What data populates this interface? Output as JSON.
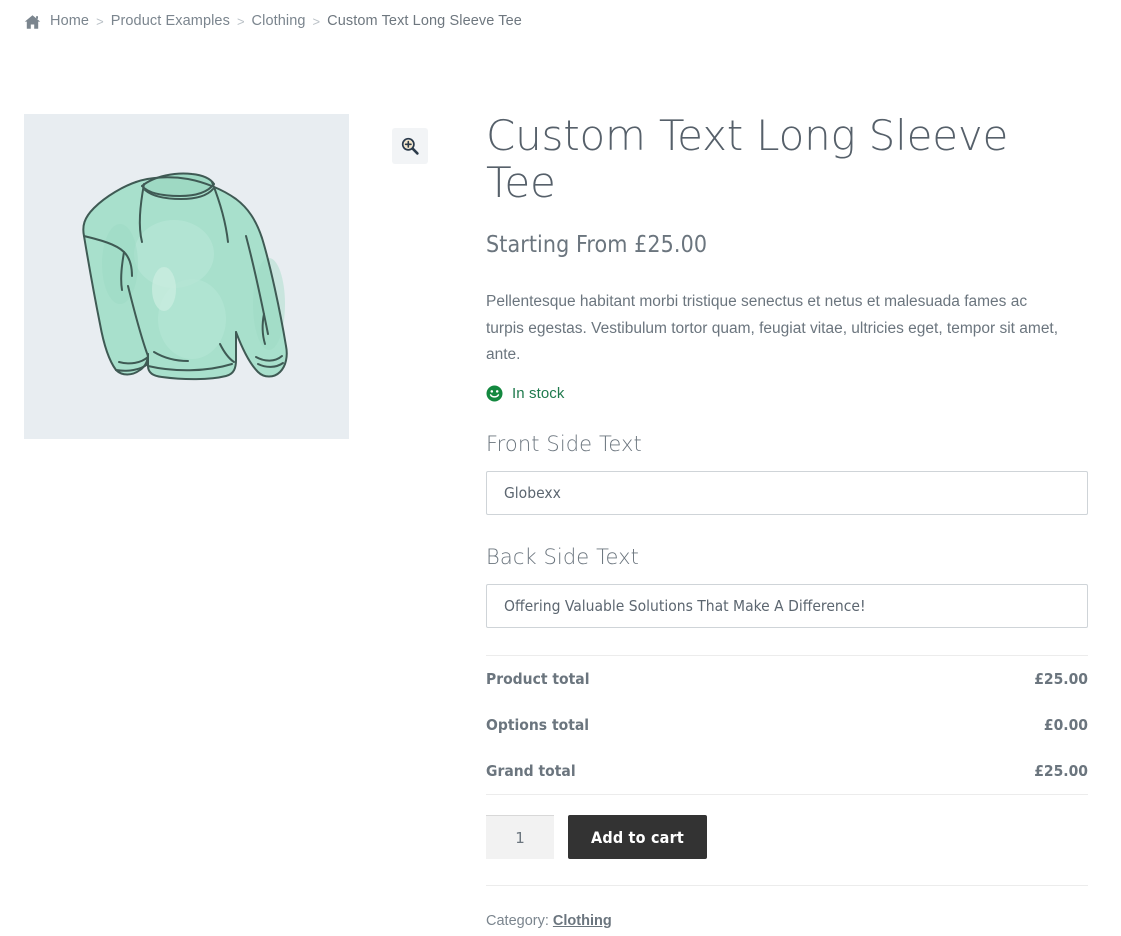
{
  "breadcrumb": {
    "home_icon": "home-icon",
    "separator": ">",
    "items": [
      {
        "label": "Home",
        "current": false
      },
      {
        "label": "Product Examples",
        "current": false
      },
      {
        "label": "Clothing",
        "current": false
      },
      {
        "label": "Custom Text Long Sleeve Tee",
        "current": true
      }
    ]
  },
  "gallery": {
    "zoom_icon": "zoom-in-magnifier-icon",
    "image_alt": "Mint green long sleeve tee illustration",
    "background_color": "#e8edf1",
    "garment_color": "#a8e0cc"
  },
  "product": {
    "title": "Custom Text Long Sleeve Tee",
    "price": "Starting From £25.00",
    "description": "Pellentesque habitant morbi tristique senectus et netus et malesuada fames ac turpis egestas. Vestibulum tortor quam, feugiat vitae, ultricies eget, tempor sit amet, ante.",
    "stock_status": "In stock",
    "stock_icon": "smiley-face-icon",
    "stock_color": "#1f7a4d"
  },
  "fields": [
    {
      "label": "Front Side Text",
      "value": "Globexx",
      "placeholder": ""
    },
    {
      "label": "Back Side Text",
      "value": "Offering Valuable Solutions That Make A Difference!",
      "placeholder": ""
    }
  ],
  "totals": [
    {
      "label": "Product total",
      "value": "£25.00"
    },
    {
      "label": "Options total",
      "value": "£0.00"
    },
    {
      "label": "Grand total",
      "value": "£25.00"
    }
  ],
  "cart": {
    "quantity": "1",
    "add_to_cart_label": "Add to cart"
  },
  "meta": {
    "category_label": "Category:",
    "category_value": "Clothing"
  }
}
